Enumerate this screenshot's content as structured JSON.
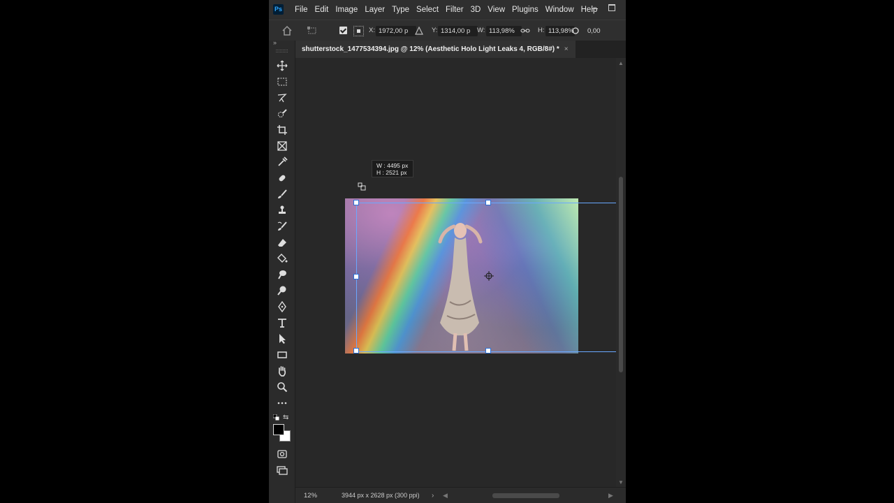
{
  "app": {
    "logo_text": "Ps"
  },
  "menu": [
    "File",
    "Edit",
    "Image",
    "Layer",
    "Type",
    "Select",
    "Filter",
    "3D",
    "View",
    "Plugins",
    "Window",
    "Help"
  ],
  "options": {
    "x_label": "X:",
    "x_value": "1972,00 p",
    "y_label": "Y:",
    "y_value": "1314,00 p",
    "w_label": "W:",
    "w_value": "113,98%",
    "h_label": "H:",
    "h_value": "113,98%",
    "angle_value": "0,00",
    "link_active": true
  },
  "document": {
    "tab_title": "shutterstock_1477534394.jpg @ 12% (Aesthetic Holo Light Leaks 4, RGB/8#) *",
    "close_glyph": "×"
  },
  "tooltip": {
    "w": "W :  4495 px",
    "h": "H :  2521 px"
  },
  "status": {
    "zoom": "12%",
    "doc_info": "3944 px x 2628 px (300 ppi)",
    "arrow": "›"
  },
  "toolbar": {
    "collapse": "»",
    "tools": [
      "move-tool",
      "marquee-tool",
      "lasso-tool",
      "quick-select-tool",
      "crop-tool",
      "frame-tool",
      "eyedropper-tool",
      "healing-brush-tool",
      "brush-tool",
      "clone-stamp-tool",
      "history-brush-tool",
      "eraser-tool",
      "paint-bucket-tool",
      "smudge-tool",
      "dodge-tool",
      "pen-tool",
      "type-tool",
      "path-select-tool",
      "rectangle-tool",
      "hand-tool",
      "zoom-tool",
      "more-tools"
    ],
    "foreground_color": "#000000",
    "background_color": "#ffffff"
  },
  "colors": {
    "accent": "#6aa8ff",
    "ps_blue": "#31a8ff"
  }
}
